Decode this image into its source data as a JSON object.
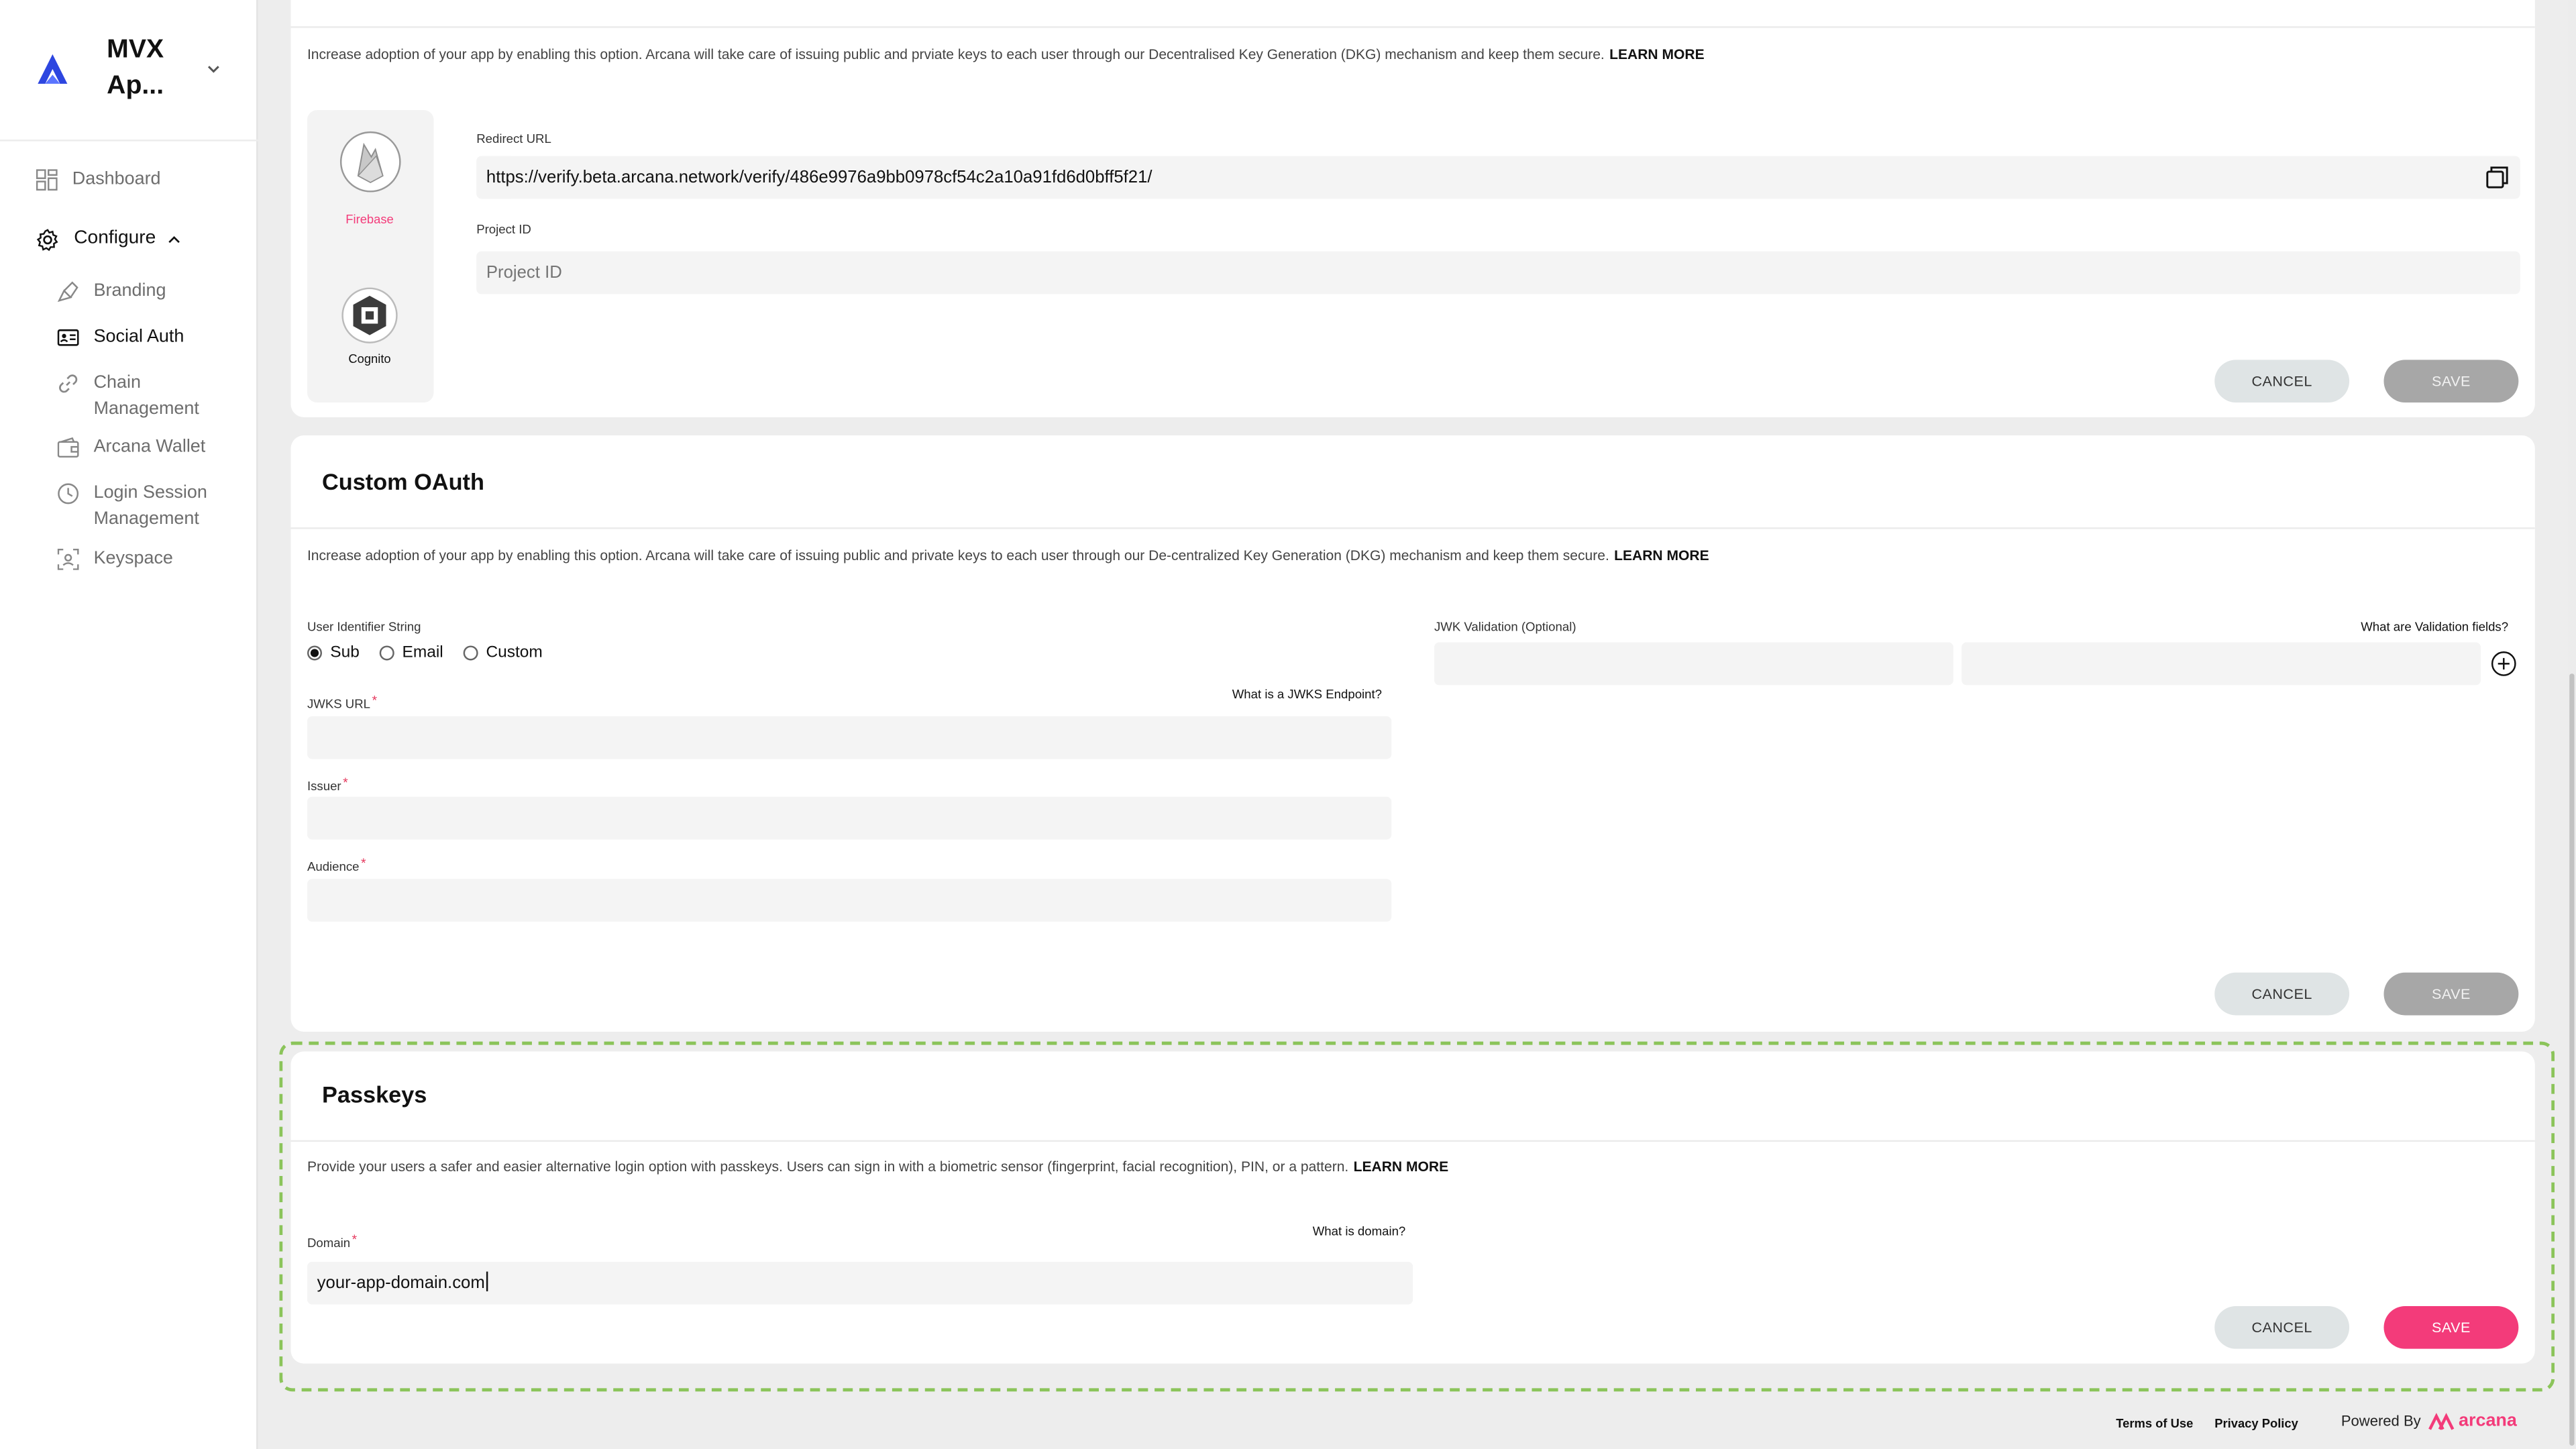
{
  "app": {
    "name": "MVX Ap..."
  },
  "sidebar": {
    "items": [
      {
        "id": "dashboard",
        "label": "Dashboard"
      },
      {
        "id": "configure",
        "label": "Configure"
      },
      {
        "id": "branding",
        "label": "Branding"
      },
      {
        "id": "social-auth",
        "label": "Social Auth"
      },
      {
        "id": "chain-management",
        "label": "Chain Management"
      },
      {
        "id": "arcana-wallet",
        "label": "Arcana Wallet"
      },
      {
        "id": "login-session",
        "label": "Login Session Management"
      },
      {
        "id": "keyspace",
        "label": "Keyspace"
      }
    ]
  },
  "top_section": {
    "description": "Increase adoption of your app by enabling this option. Arcana will take care of issuing public and prviate keys to each user through our Decentralised Key Generation (DKG) mechanism and keep them secure.",
    "learn_more": "LEARN MORE",
    "providers": [
      {
        "label": "Firebase"
      },
      {
        "label": "Cognito"
      }
    ],
    "redirect_label": "Redirect URL",
    "redirect_value": "https://verify.beta.arcana.network/verify/486e9976a9bb0978cf54c2a10a91fd6d0bff5f21/",
    "project_id_label": "Project ID",
    "project_id_placeholder": "Project ID",
    "cancel": "CANCEL",
    "save": "SAVE"
  },
  "custom_oauth": {
    "title": "Custom OAuth",
    "description": "Increase adoption of your app by enabling this option. Arcana will take care of issuing public and private keys to each user through our De-centralized Key Generation (DKG) mechanism and keep them secure.",
    "learn_more": "LEARN MORE",
    "user_identifier_label": "User Identifier String",
    "options": [
      "Sub",
      "Email",
      "Custom"
    ],
    "selected_option": "Sub",
    "jwks_url_label": "JWKS URL",
    "jwks_help": "What is a JWKS Endpoint?",
    "issuer_label": "Issuer",
    "audience_label": "Audience",
    "jwk_validation_label": "JWK Validation (Optional)",
    "validation_help": "What are Validation fields?",
    "cancel": "CANCEL",
    "save": "SAVE"
  },
  "passkeys": {
    "title": "Passkeys",
    "description": "Provide your users a safer and easier alternative login option with passkeys. Users can sign in with a biometric sensor (fingerprint, facial recognition), PIN, or a pattern.",
    "learn_more": "LEARN MORE",
    "domain_label": "Domain",
    "domain_help": "What is domain?",
    "domain_value": "your-app-domain.com",
    "cancel": "CANCEL",
    "save": "SAVE"
  },
  "footer": {
    "terms": "Terms of Use",
    "privacy": "Privacy Policy",
    "powered_by": "Powered By",
    "brand": "arcana"
  },
  "colors": {
    "accent": "#f33b7a",
    "logo": "#2d46e0",
    "highlight": "#8bc45a"
  }
}
